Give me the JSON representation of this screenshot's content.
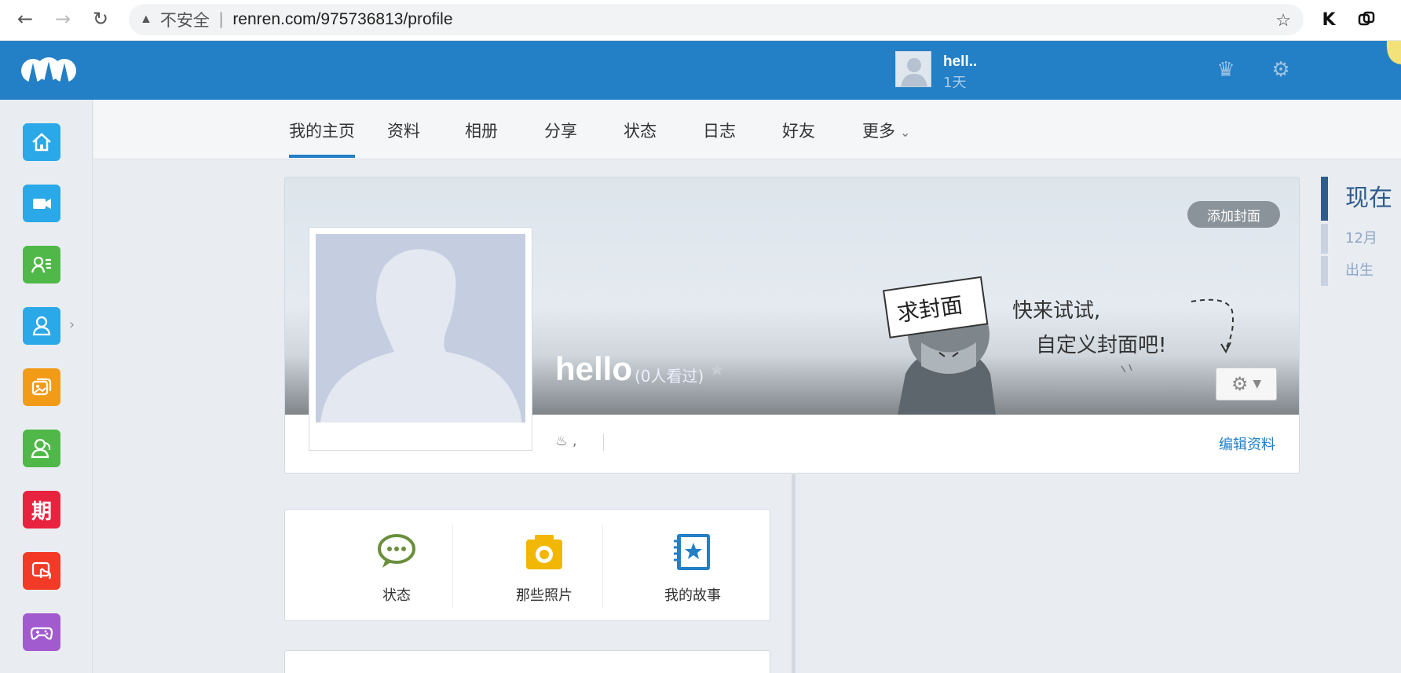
{
  "browser": {
    "security_label": "不安全",
    "url": "renren.com/975736813/profile"
  },
  "header": {
    "user_name": "hell..",
    "user_days": "1天"
  },
  "tabs": [
    {
      "label": "我的主页"
    },
    {
      "label": "资料"
    },
    {
      "label": "相册"
    },
    {
      "label": "分享"
    },
    {
      "label": "状态"
    },
    {
      "label": "日志"
    },
    {
      "label": "好友"
    },
    {
      "label": "更多"
    }
  ],
  "sidebar": {
    "apps": [
      {
        "icon": "home-icon",
        "color": "#2aa8e8"
      },
      {
        "icon": "video-icon",
        "color": "#2aa8e8"
      },
      {
        "icon": "contact-card-icon",
        "color": "#4fb848"
      },
      {
        "icon": "person-icon",
        "color": "#2aa8e8"
      },
      {
        "icon": "photo-album-icon",
        "color": "#f29b16"
      },
      {
        "icon": "friends-icon",
        "color": "#4fb848"
      },
      {
        "icon": "issue-icon",
        "color": "#e8233f",
        "text": "期"
      },
      {
        "icon": "hand-touch-icon",
        "color": "#f23a26"
      },
      {
        "icon": "gamepad-icon",
        "color": "#a25bcf"
      }
    ]
  },
  "profile": {
    "add_cover_label": "添加封面",
    "name": "hello",
    "views": "(0人看过)",
    "info_text": ",",
    "edit_label": "编辑资料",
    "cover_sign_text": "求封面",
    "cover_line1": "快来试试,",
    "cover_line2": "自定义封面吧!"
  },
  "timeline": {
    "now": "现在",
    "month": "12月",
    "birth": "出生"
  },
  "actions": [
    {
      "label": "状态",
      "icon": "speech-bubble-icon",
      "color": "#6a8f3c"
    },
    {
      "label": "那些照片",
      "icon": "camera-icon",
      "color": "#f2b705"
    },
    {
      "label": "我的故事",
      "icon": "story-book-icon",
      "color": "#237fc6"
    }
  ]
}
